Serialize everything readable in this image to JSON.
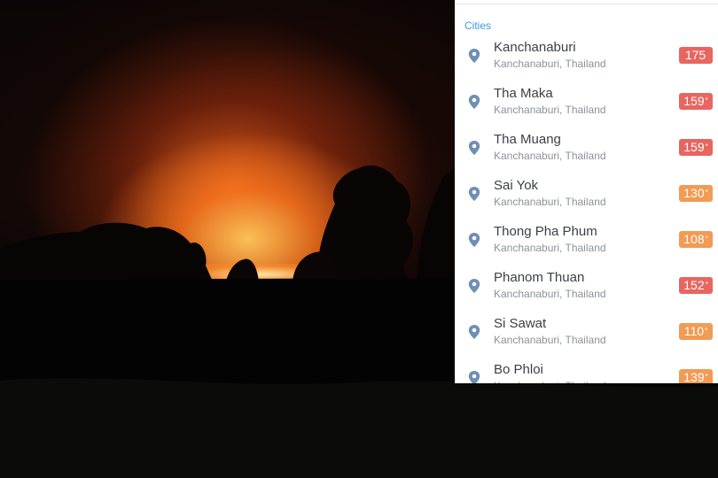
{
  "panel": {
    "section_header": "Cities",
    "cities": [
      {
        "name": "Kanchanaburi",
        "location": "Kanchanaburi, Thailand",
        "aqi": "175",
        "mark": "",
        "color": "#e8665f"
      },
      {
        "name": "Tha Maka",
        "location": "Kanchanaburi, Thailand",
        "aqi": "159",
        "mark": "*",
        "color": "#e8665f"
      },
      {
        "name": "Tha Muang",
        "location": "Kanchanaburi, Thailand",
        "aqi": "159",
        "mark": "*",
        "color": "#e8665f"
      },
      {
        "name": "Sai Yok",
        "location": "Kanchanaburi, Thailand",
        "aqi": "130",
        "mark": "*",
        "color": "#f19b55"
      },
      {
        "name": "Thong Pha Phum",
        "location": "Kanchanaburi, Thailand",
        "aqi": "108",
        "mark": "*",
        "color": "#f19b55"
      },
      {
        "name": "Phanom Thuan",
        "location": "Kanchanaburi, Thailand",
        "aqi": "152",
        "mark": "*",
        "color": "#e8665f"
      },
      {
        "name": "Si Sawat",
        "location": "Kanchanaburi, Thailand",
        "aqi": "110",
        "mark": "*",
        "color": "#f19b55"
      },
      {
        "name": "Bo Phloi",
        "location": "Kanchanaburi, Thailand",
        "aqi": "139",
        "mark": "*",
        "color": "#f19b55"
      }
    ]
  },
  "colors": {
    "accent": "#3c9ad8",
    "pin": "#6f8fb3"
  },
  "background": {
    "icon": "night-fire-photo"
  }
}
